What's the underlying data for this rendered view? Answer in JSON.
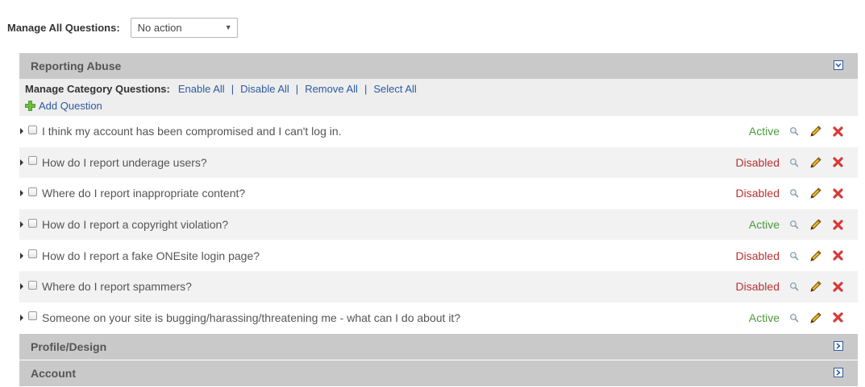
{
  "manage_all": {
    "label": "Manage All Questions:",
    "select_value": "No action"
  },
  "categories": [
    {
      "title": "Reporting Abuse",
      "expanded": true,
      "manage_label": "Manage Category Questions:",
      "actions": [
        "Enable All",
        "Disable All",
        "Remove All",
        "Select All"
      ],
      "add_question": "Add Question",
      "questions": [
        {
          "text": "I think my account has been compromised and I can't log in.",
          "status": "Active"
        },
        {
          "text": "How do I report underage users?",
          "status": "Disabled"
        },
        {
          "text": "Where do I report inappropriate content?",
          "status": "Disabled"
        },
        {
          "text": "How do I report a copyright violation?",
          "status": "Active"
        },
        {
          "text": "How do I report a fake ONEsite login page?",
          "status": "Disabled"
        },
        {
          "text": "Where do I report spammers?",
          "status": "Disabled"
        },
        {
          "text": "Someone on your site is bugging/harassing/threatening me - what can I do about it?",
          "status": "Active"
        }
      ]
    },
    {
      "title": "Profile/Design",
      "expanded": false
    },
    {
      "title": "Account",
      "expanded": false
    }
  ],
  "colors": {
    "active": "#4a9a3a",
    "disabled": "#b83232",
    "link": "#2c5aa0",
    "header_bg": "#c9c9c9"
  },
  "icons": {
    "row_icons": [
      "view-magnifier-icon",
      "edit-pencil-icon",
      "delete-x-icon"
    ]
  }
}
